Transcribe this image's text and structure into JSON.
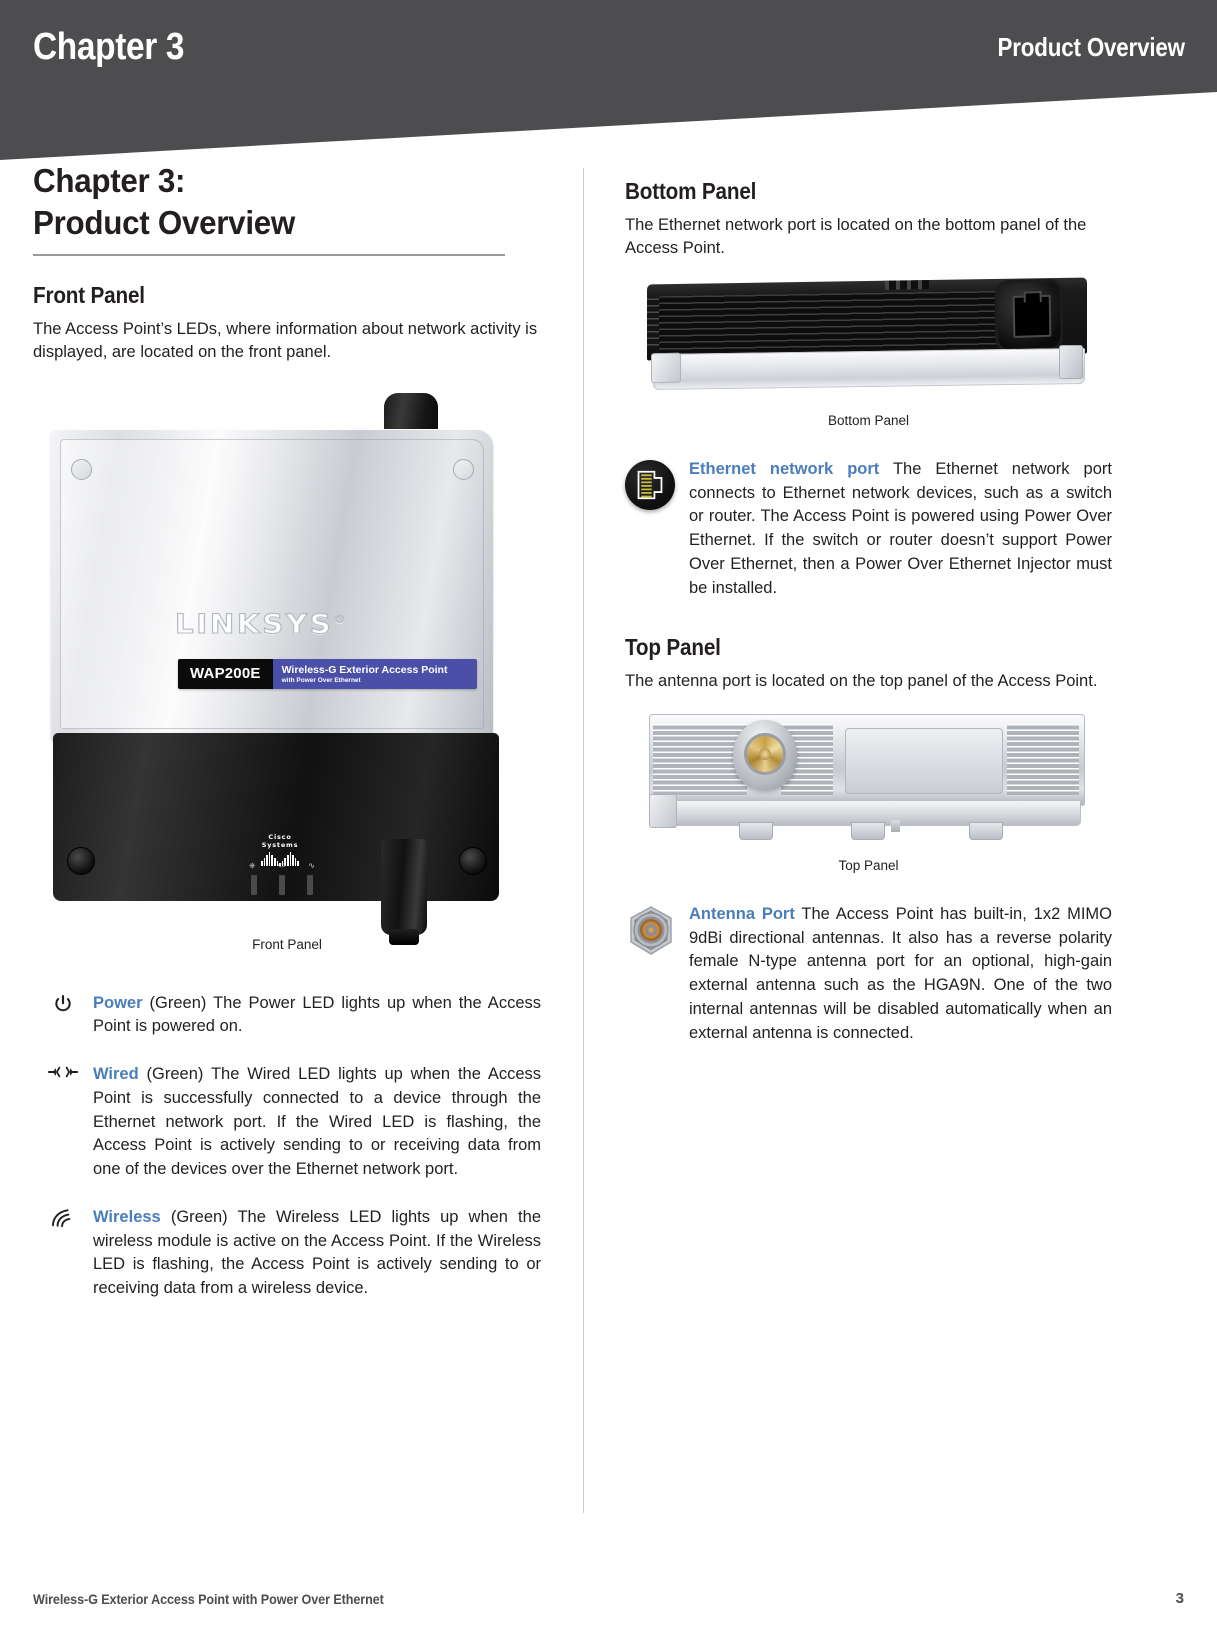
{
  "header": {
    "chapter_label": "Chapter 3",
    "topic_label": "Product Overview",
    "background_color": "#4d4d4f"
  },
  "accent_color": "#4a7ebb",
  "left_column": {
    "title_line1": "Chapter 3:",
    "title_line2": "Product Overview",
    "front_panel": {
      "heading": "Front Panel",
      "intro": "The Access Point’s LEDs, where information about network activity is displayed, are located on the front panel.",
      "image_caption": "Front Panel",
      "device": {
        "brand": "LINKSYS",
        "registered_mark": "®",
        "model": "WAP200E",
        "product_line": "Wireless-G Exterior Access Point",
        "product_sub": "with Power Over Ethernet",
        "oem_brand": "Cisco Systems"
      }
    },
    "leds": [
      {
        "icon": "power-icon",
        "label": "Power",
        "text": " (Green) The Power LED lights up when the Access Point is powered on."
      },
      {
        "icon": "wired-icon",
        "label": "Wired",
        "text": " (Green) The Wired LED lights up when the Access Point is successfully connected to a device through the Ethernet network port. If the Wired LED is flashing, the Access Point is actively sending to or receiving data from one of the devices over the Ethernet network port."
      },
      {
        "icon": "wireless-icon",
        "label": "Wireless",
        "text": " (Green) The Wireless LED lights up when the wireless module is active on the Access Point. If the Wireless LED is flashing, the Access Point is actively sending to or receiving data from a wireless device."
      }
    ]
  },
  "right_column": {
    "bottom_panel": {
      "heading": "Bottom Panel",
      "intro": "The Ethernet network port is located on the bottom panel of the Access Point.",
      "image_caption": "Bottom Panel",
      "port": {
        "icon": "rj45-ethernet-icon",
        "label": "Ethernet network port",
        "text": " The Ethernet network port connects to Ethernet network devices, such as a switch or router. The Access Point is powered using Power Over Ethernet. If the switch or router doesn’t support Power Over Ethernet, then a Power Over Ethernet Injector must be installed."
      }
    },
    "top_panel": {
      "heading": "Top Panel",
      "intro": "The antenna port is located on the top panel of the Access Point.",
      "image_caption": "Top Panel",
      "port": {
        "icon": "n-type-antenna-connector-icon",
        "label": "Antenna Port",
        "text": " The Access Point has built-in, 1x2 MIMO 9dBi directional antennas. It also has a reverse polarity female N-type antenna port for an optional, high-gain external antenna such as the HGA9N. One of the two internal antennas will be disabled automatically when an external antenna is connected."
      }
    }
  },
  "footer": {
    "product_name": "Wireless-G Exterior Access Point with Power Over Ethernet",
    "page_number": "3"
  }
}
